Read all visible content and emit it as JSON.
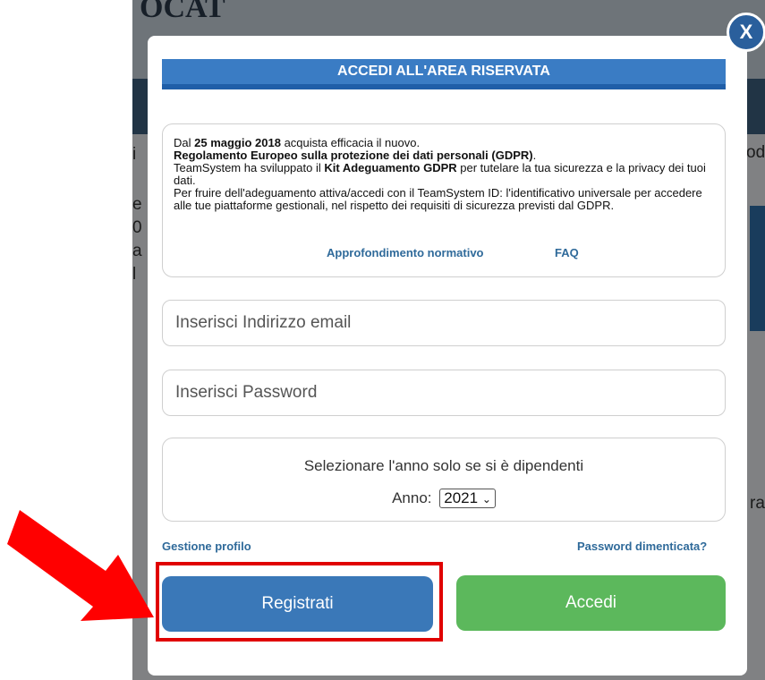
{
  "background": {
    "banner_text": "OCAT",
    "left_fragments": [
      "i",
      "e",
      "0",
      "a",
      "l"
    ],
    "right_fragment_1": "od",
    "right_fragment_2": "ra"
  },
  "modal": {
    "close_label": "X",
    "title": "ACCEDI ALL'AREA RISERVATA",
    "info": {
      "line1_a": "Dal ",
      "line1_b": "25 maggio 2018",
      "line1_c": " acquista efficacia il nuovo.",
      "line2": "Regolamento Europeo sulla protezione dei dati personali (GDPR)",
      "line2_end": ".",
      "line3_a": "TeamSystem ha sviluppato il ",
      "line3_b": "Kit Adeguamento GDPR",
      "line3_c": " per tutelare la tua sicurezza e la privacy dei tuoi dati.",
      "line4": "Per fruire dell'adeguamento attiva/accedi con il TeamSystem ID: l'identificativo universale per accedere alle tue piattaforme gestionali, nel rispetto dei requisiti di sicurezza previsti dal GDPR.",
      "link_norm": "Approfondimento normativo",
      "link_faq": "FAQ"
    },
    "email_placeholder": "Inserisci Indirizzo email",
    "password_placeholder": "Inserisci Password",
    "year_hint": "Selezionare l'anno solo se si è dipendenti",
    "year_label": "Anno:",
    "year_value": "2021",
    "profile_link": "Gestione profilo",
    "forgot_link": "Password dimenticata?",
    "register_label": "Registrati",
    "login_label": "Accedi"
  },
  "annotation": {
    "arrow_color": "#ff0000",
    "frame_color": "#e00000"
  }
}
